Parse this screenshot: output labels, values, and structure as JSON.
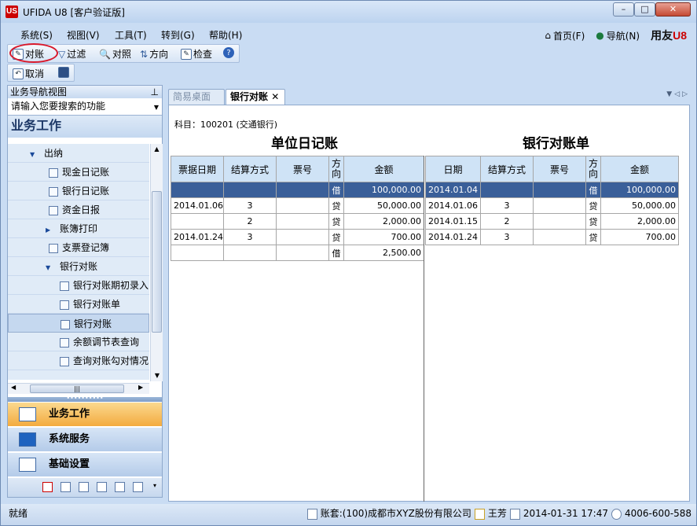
{
  "window": {
    "title": "UFIDA U8 [客户验证版]",
    "logo": "US",
    "controls": {
      "minimize": "–",
      "maximize": "□",
      "close": "✕"
    }
  },
  "menu": {
    "items": [
      "系统(S)",
      "视图(V)",
      "工具(T)",
      "转到(G)",
      "帮助(H)"
    ],
    "home": "首页(F)",
    "navigate": "导航(N)",
    "brand_text": "用友",
    "brand_mark": "U8"
  },
  "toolbar": {
    "reconcile": "对账",
    "filter": "过滤",
    "compare": "对照",
    "direction": "方向",
    "check": "检查",
    "cancel": "取消"
  },
  "nav": {
    "header": "业务导航视图",
    "search_placeholder": "请输入您要搜索的功能",
    "section": "业务工作",
    "tree": [
      {
        "label": "出纳",
        "icon": "expand-arrow"
      },
      {
        "label": "现金日记账",
        "icon": "doc-icon"
      },
      {
        "label": "银行日记账",
        "icon": "doc-icon"
      },
      {
        "label": "资金日报",
        "icon": "doc-icon"
      },
      {
        "label": "账簿打印",
        "icon": "collapse-arrow"
      },
      {
        "label": "支票登记簿",
        "icon": "doc-icon"
      },
      {
        "label": "银行对账",
        "icon": "expand-arrow"
      },
      {
        "label": "银行对账期初录入",
        "icon": "doc-icon"
      },
      {
        "label": "银行对账单",
        "icon": "doc-icon"
      },
      {
        "label": "银行对账",
        "icon": "doc-icon"
      },
      {
        "label": "余额调节表查询",
        "icon": "doc-icon"
      },
      {
        "label": "查询对账勾对情况",
        "icon": "doc-icon"
      }
    ],
    "big_buttons": [
      "业务工作",
      "系统服务",
      "基础设置"
    ]
  },
  "tabs": [
    "简易桌面",
    "银行对账"
  ],
  "doc": {
    "subject": "科目：100201 (交通银行)",
    "left_title": "单位日记账",
    "right_title": "银行对账单",
    "left_headers": [
      "票据日期",
      "结算方式",
      "票号",
      "方向",
      "金额"
    ],
    "right_headers": [
      "日期",
      "结算方式",
      "票号",
      "方向",
      "金额"
    ],
    "left_rows": [
      [
        "",
        "",
        "",
        "借",
        "100,000.00"
      ],
      [
        "2014.01.06",
        "3",
        "",
        "贷",
        "50,000.00"
      ],
      [
        "",
        "2",
        "",
        "贷",
        "2,000.00"
      ],
      [
        "2014.01.24",
        "3",
        "",
        "贷",
        "700.00"
      ],
      [
        "",
        "",
        "",
        "借",
        "2,500.00"
      ]
    ],
    "right_rows": [
      [
        "2014.01.04",
        "",
        "",
        "借",
        "100,000.00"
      ],
      [
        "2014.01.06",
        "3",
        "",
        "贷",
        "50,000.00"
      ],
      [
        "2014.01.15",
        "2",
        "",
        "贷",
        "2,000.00"
      ],
      [
        "2014.01.24",
        "3",
        "",
        "贷",
        "700.00"
      ]
    ]
  },
  "status": {
    "ready": "就绪",
    "account": "账套:(100)成都市XYZ股份有限公司",
    "user": "王芳",
    "datetime": "2014-01-31 17:47",
    "phone": "4006-600-588"
  }
}
